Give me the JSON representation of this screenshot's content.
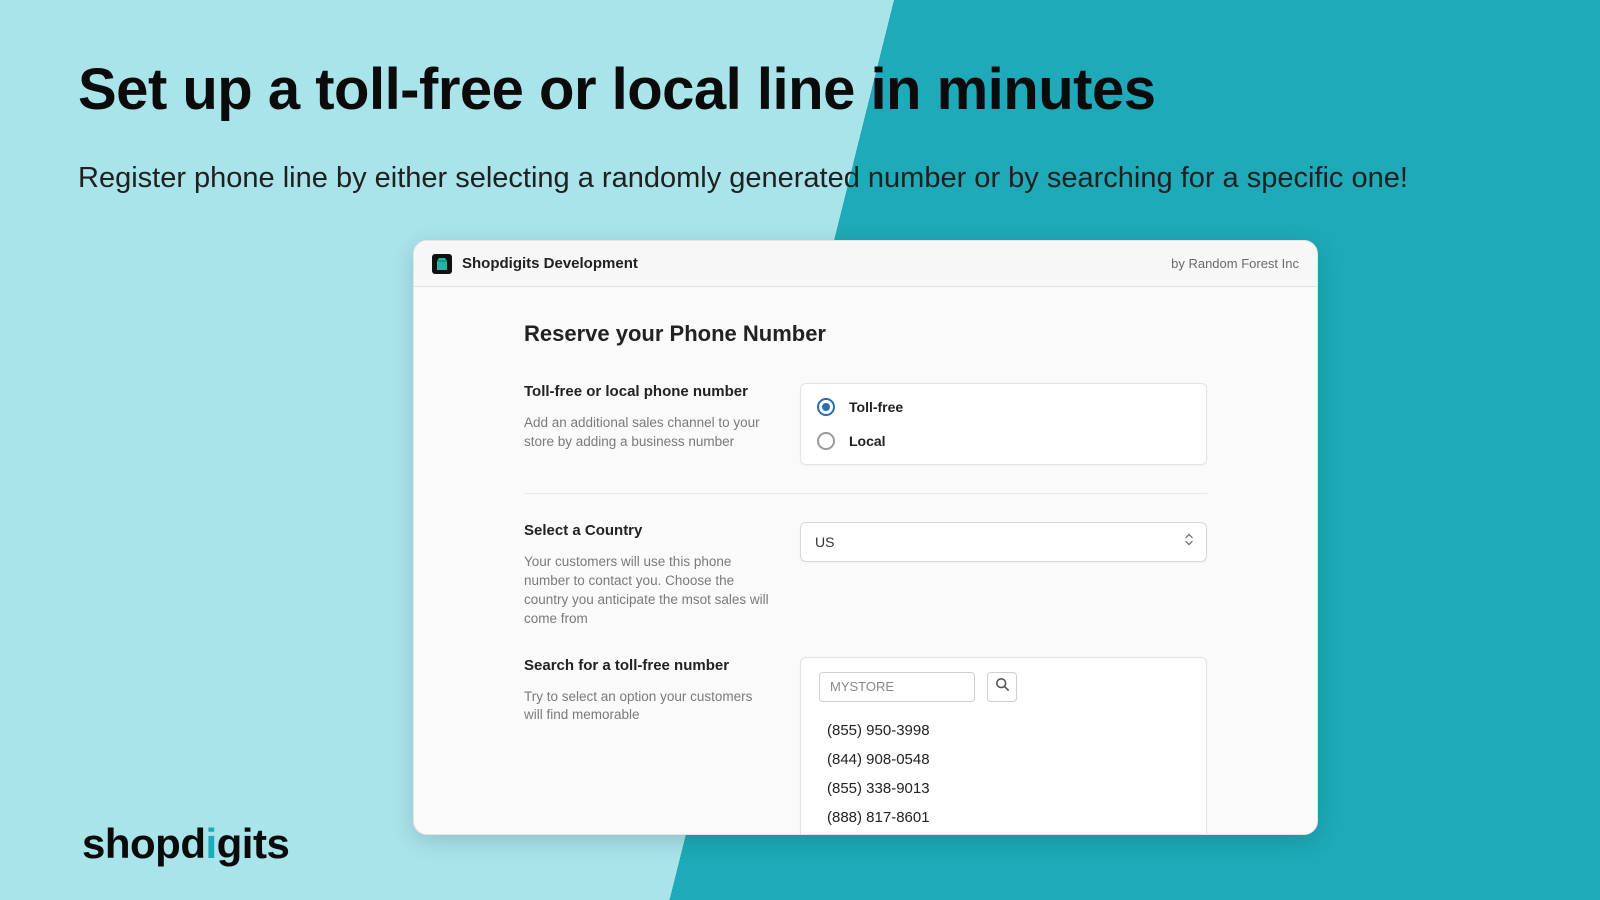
{
  "hero": {
    "title": "Set up a toll-free or local line in minutes",
    "subtitle": "Register phone line by either selecting a randomly generated number or by searching for a specific one!"
  },
  "brand": {
    "pre": "shopd",
    "accent": "i",
    "post": "gits"
  },
  "card": {
    "app_name": "Shopdigits Development",
    "byline": "by Random Forest Inc",
    "title": "Reserve your Phone Number",
    "section_type": {
      "label": "Toll-free or local phone number",
      "help": "Add an additional sales channel to your store by adding a business number",
      "options": [
        "Toll-free",
        "Local"
      ],
      "selected": 0
    },
    "section_country": {
      "label": "Select a Country",
      "help": "Your customers will use this phone number to contact you. Choose the country you anticipate the msot sales will come from",
      "value": "US"
    },
    "section_search": {
      "label": "Search for a toll-free number",
      "help": "Try to select an option your customers will find memorable",
      "input_value": "MYSTORE",
      "results": [
        "(855) 950-3998",
        "(844) 908-0548",
        "(855) 338-9013",
        "(888) 817-8601"
      ]
    }
  }
}
